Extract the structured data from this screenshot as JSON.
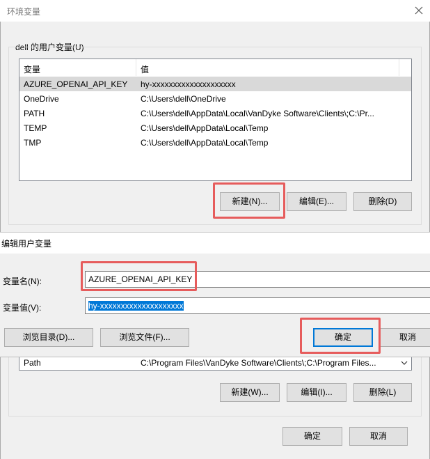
{
  "env_window": {
    "title": "环境变量",
    "close_icon": "close-icon",
    "user_group_label": "dell 的用户变量(U)",
    "columns": [
      "变量",
      "值"
    ],
    "user_vars": [
      {
        "name": "AZURE_OPENAI_API_KEY",
        "value": "hy-xxxxxxxxxxxxxxxxxxxx",
        "selected": true
      },
      {
        "name": "OneDrive",
        "value": "C:\\Users\\dell\\OneDrive",
        "selected": false
      },
      {
        "name": "PATH",
        "value": "C:\\Users\\dell\\AppData\\Local\\VanDyke Software\\Clients\\;C:\\Pr...",
        "selected": false
      },
      {
        "name": "TEMP",
        "value": "C:\\Users\\dell\\AppData\\Local\\Temp",
        "selected": false
      },
      {
        "name": "TMP",
        "value": "C:\\Users\\dell\\AppData\\Local\\Temp",
        "selected": false
      }
    ],
    "user_buttons": {
      "new": "新建(N)...",
      "edit": "编辑(E)...",
      "delete": "删除(D)"
    },
    "system_row": {
      "name": "Path",
      "value": "C:\\Program Files\\VanDyke Software\\Clients\\;C:\\Program Files..."
    },
    "system_buttons": {
      "new": "新建(W)...",
      "edit": "编辑(I)...",
      "delete": "删除(L)"
    },
    "ok_label": "确定",
    "cancel_label": "取消",
    "highlight_color": "#e65c5c"
  },
  "edit_dialog": {
    "title": "编辑用户变量",
    "name_label": "变量名(N):",
    "name_value": "AZURE_OPENAI_API_KEY",
    "value_label": "变量值(V):",
    "value_value": "hy-xxxxxxxxxxxxxxxxxxxx",
    "browse_dir": "浏览目录(D)...",
    "browse_file": "浏览文件(F)...",
    "ok_label": "确定",
    "cancel_label": "取消"
  }
}
